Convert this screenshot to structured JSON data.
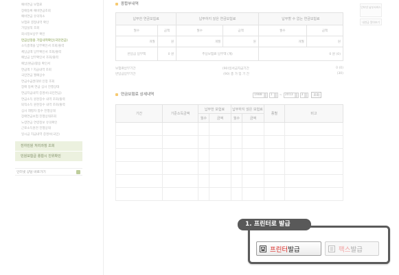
{
  "sidebar": {
    "items": [
      "예비연금 보험료",
      "장애등록 예비연금조회",
      "예비연금 유의적소",
      "보험료 결정내역 확인",
      "가입실적 조회",
      "회사정보납부 확인",
      "연금산정용 가입내역확인(국민연금)",
      "소득총액을 납부확인서 조회/출력",
      "체납금액 납부확인서 조회/출력",
      "예납금 납부확인서 조회/출력",
      "예납(환급)활용 확인서",
      "연금액 ? 지급내역 조회",
      "국민연금 월예상수",
      "연금수급권대위 인정 조회",
      "장애 등록 연금 심사 진행상태",
      "연금지급내역 증명서(국민연금)",
      "연금소득 원천징수 내역 조회/출력",
      "퇴직소득 원천징수 내역 조회/출력",
      "심사 래평차 접수 진행상태",
      "장애연금보험 진행상태조회",
      "노령연금 연령정보 유의확인",
      "근로소득원천 진행상태",
      "일시금 지급내역 증명서(국민)"
    ],
    "active_index": 6,
    "boxes": [
      "전자민원 처리과정 조회",
      "민원보험급 종합시 진위확인"
    ],
    "link": "인터넷 상담 바로가기"
  },
  "section1": {
    "title": "종합부내역",
    "headers": [
      "납부한 연금보험료",
      "납부하지 않은 연금보험료",
      "납부할 수 없는 연금보험료"
    ],
    "subheaders": [
      "월수",
      "금액",
      "월수",
      "금액",
      "월수",
      "금액"
    ],
    "row": [
      "개월",
      "원",
      "개월",
      "원",
      "개월",
      "원"
    ],
    "total_label": "반납금 납부액",
    "total_value": "0 원",
    "sum_label": "추납보험료 납부액 (계)",
    "sum_value": "0 원 (0)",
    "info": [
      {
        "left": "보험료납부기간",
        "mid": "(90)일서금지급기간",
        "right": "0 (0)"
      },
      {
        "left": "반납금납부기간",
        "mid": "(90) 총 가 입 기 간",
        "right": "(30)"
      }
    ]
  },
  "section2": {
    "title": "연금보험료 상세내역",
    "from_year": "1988",
    "from_month": "1",
    "to_year": "2013",
    "to_month": "3",
    "view_label": "조회",
    "headers": [
      "기간",
      "기준소득금액",
      "납부한 보험료",
      "납부하지 않은 보험료",
      "종별",
      "비고"
    ],
    "subheaders": [
      "월수",
      "금액",
      "월수",
      "금액"
    ]
  },
  "right_badges": [
    "인터넷 납부서비스",
    "내연금 알아보기"
  ],
  "callout": {
    "number": "1.",
    "text": "프린터로 발급"
  },
  "buttons": {
    "print_accent": "프린터",
    "print_rest": " 발급",
    "fax_accent": "팩스",
    "fax_rest": " 발급"
  },
  "colors": {
    "print_accent": "#d9231d",
    "fax_accent": "#f2a3a3",
    "callout_bg": "#595959",
    "sidebar_box": "#dde7c6"
  }
}
